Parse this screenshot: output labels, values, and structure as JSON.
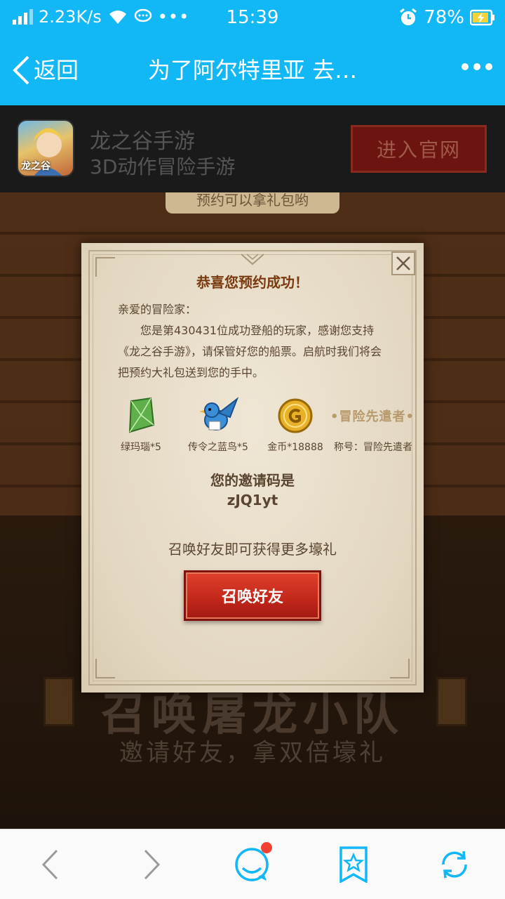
{
  "status_bar": {
    "net_speed": "2.23K/s",
    "time": "15:39",
    "battery": "78%",
    "icons": [
      "signal-icon",
      "wifi-icon",
      "message-icon",
      "more-dots-icon",
      "alarm-icon",
      "battery-charging-icon"
    ]
  },
  "nav": {
    "back_label": "返回",
    "title": "为了阿尔特里亚 去…"
  },
  "app_banner": {
    "icon_text": "龙之谷",
    "name": "龙之谷手游",
    "subtitle": "3D动作冒险手游",
    "enter_label": "进入官网"
  },
  "background": {
    "bubble_text": "预约可以拿礼包哟",
    "heading": "召唤屠龙小队",
    "subheading": "邀请好友，拿双倍壕礼"
  },
  "modal": {
    "title": "恭喜您预约成功！",
    "greeting": "亲爱的冒险家：",
    "message": "您是第430431位成功登船的玩家，感谢您支持《龙之谷手游》，请保管好您的船票。启航时我们将会把预约大礼包送到您的手中。",
    "rewards": [
      {
        "icon": "green-gem-icon",
        "label": "绿玛瑙*5"
      },
      {
        "icon": "blue-bird-icon",
        "label": "传令之蓝鸟*5"
      },
      {
        "icon": "gold-coin-icon",
        "label": "金币*18888"
      },
      {
        "icon": "title-badge",
        "badge": "•冒险先遣者•",
        "label": "称号：冒险先遣者"
      }
    ],
    "invite_heading": "您的邀请码是",
    "invite_code": "zJQ1yt",
    "invite_tip": "召唤好友即可获得更多壕礼",
    "summon_label": "召唤好友"
  },
  "toolbar": {
    "icons": [
      "back-arrow-icon",
      "forward-arrow-icon",
      "chat-icon",
      "bookmark-star-icon",
      "refresh-icon"
    ],
    "accent": "#12b7f5",
    "badge_color": "#f04030"
  }
}
